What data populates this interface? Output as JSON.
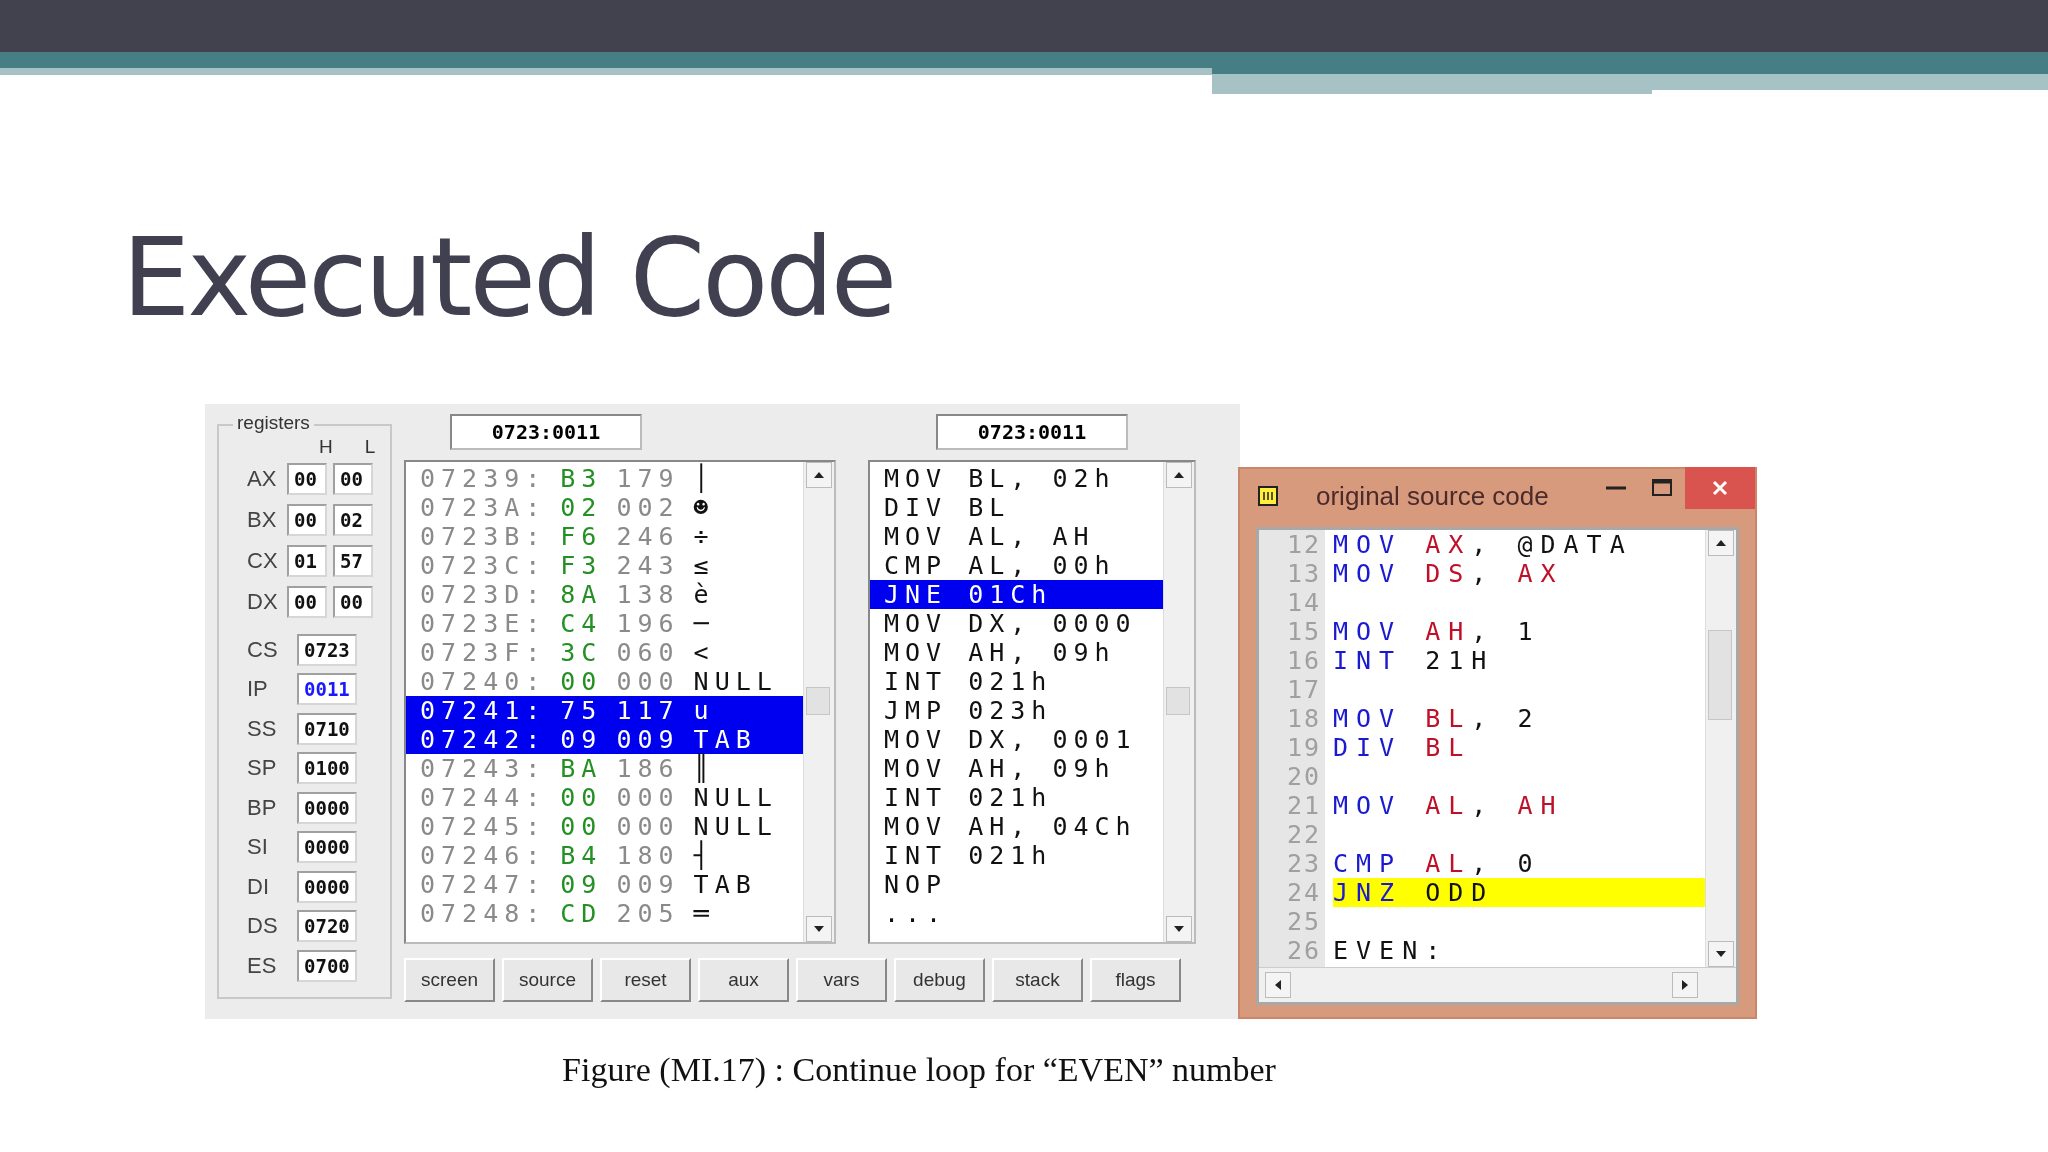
{
  "slide": {
    "title": "Executed Code",
    "caption": "Figure (MI.17) : Continue  loop for “EVEN” number"
  },
  "emulator": {
    "registers": {
      "label": "registers",
      "columns": [
        "H",
        "L"
      ],
      "pairs": [
        {
          "name": "AX",
          "high": "00",
          "low": "00"
        },
        {
          "name": "BX",
          "high": "00",
          "low": "02"
        },
        {
          "name": "CX",
          "high": "01",
          "low": "57"
        },
        {
          "name": "DX",
          "high": "00",
          "low": "00"
        }
      ],
      "segments": [
        {
          "name": "CS",
          "value": "0723",
          "changed": false
        },
        {
          "name": "IP",
          "value": "0011",
          "changed": true
        },
        {
          "name": "SS",
          "value": "0710",
          "changed": false
        },
        {
          "name": "SP",
          "value": "0100",
          "changed": false
        },
        {
          "name": "BP",
          "value": "0000",
          "changed": false
        },
        {
          "name": "SI",
          "value": "0000",
          "changed": false
        },
        {
          "name": "DI",
          "value": "0000",
          "changed": false
        },
        {
          "name": "DS",
          "value": "0720",
          "changed": false
        },
        {
          "name": "ES",
          "value": "0700",
          "changed": false
        }
      ]
    },
    "memory": {
      "address": "0723:0011",
      "rows": [
        {
          "address": "07239:",
          "hex": "B3",
          "decimal": "179",
          "char": "│",
          "selected": false
        },
        {
          "address": "0723A:",
          "hex": "02",
          "decimal": "002",
          "char": "☻",
          "selected": false
        },
        {
          "address": "0723B:",
          "hex": "F6",
          "decimal": "246",
          "char": "÷",
          "selected": false
        },
        {
          "address": "0723C:",
          "hex": "F3",
          "decimal": "243",
          "char": "≤",
          "selected": false
        },
        {
          "address": "0723D:",
          "hex": "8A",
          "decimal": "138",
          "char": "è",
          "selected": false
        },
        {
          "address": "0723E:",
          "hex": "C4",
          "decimal": "196",
          "char": "─",
          "selected": false
        },
        {
          "address": "0723F:",
          "hex": "3C",
          "decimal": "060",
          "char": "<",
          "selected": false
        },
        {
          "address": "07240:",
          "hex": "00",
          "decimal": "000",
          "char": "NULL",
          "selected": false
        },
        {
          "address": "07241:",
          "hex": "75",
          "decimal": "117",
          "char": "u",
          "selected": true
        },
        {
          "address": "07242:",
          "hex": "09",
          "decimal": "009",
          "char": "TAB",
          "selected": true
        },
        {
          "address": "07243:",
          "hex": "BA",
          "decimal": "186",
          "char": "║",
          "selected": false
        },
        {
          "address": "07244:",
          "hex": "00",
          "decimal": "000",
          "char": "NULL",
          "selected": false
        },
        {
          "address": "07245:",
          "hex": "00",
          "decimal": "000",
          "char": "NULL",
          "selected": false
        },
        {
          "address": "07246:",
          "hex": "B4",
          "decimal": "180",
          "char": "┤",
          "selected": false
        },
        {
          "address": "07247:",
          "hex": "09",
          "decimal": "009",
          "char": "TAB",
          "selected": false
        },
        {
          "address": "07248:",
          "hex": "CD",
          "decimal": "205",
          "char": "═",
          "selected": false
        }
      ]
    },
    "disassembly": {
      "address": "0723:0011",
      "lines": [
        {
          "text": "MOV BL, 02h",
          "selected": false
        },
        {
          "text": "DIV BL",
          "selected": false
        },
        {
          "text": "MOV AL, AH",
          "selected": false
        },
        {
          "text": "CMP AL, 00h",
          "selected": false
        },
        {
          "text": "JNE 01Ch",
          "selected": true
        },
        {
          "text": "MOV DX, 0000",
          "selected": false
        },
        {
          "text": "MOV AH, 09h",
          "selected": false
        },
        {
          "text": "INT 021h",
          "selected": false
        },
        {
          "text": "JMP 023h",
          "selected": false
        },
        {
          "text": "MOV DX, 0001",
          "selected": false
        },
        {
          "text": "MOV AH, 09h",
          "selected": false
        },
        {
          "text": "INT 021h",
          "selected": false
        },
        {
          "text": "MOV AH, 04Ch",
          "selected": false
        },
        {
          "text": "INT 021h",
          "selected": false
        },
        {
          "text": "NOP",
          "selected": false
        },
        {
          "text": "...",
          "selected": false
        }
      ]
    },
    "buttons": [
      "screen",
      "source",
      "reset",
      "aux",
      "vars",
      "debug",
      "stack",
      "flags"
    ]
  },
  "source_window": {
    "title": "original source code",
    "lines": [
      {
        "number": "12",
        "selected": false,
        "tokens": [
          {
            "text": "MOV",
            "kind": "keyword"
          },
          {
            "text": "AX",
            "kind": "register"
          },
          {
            "text": ",",
            "kind": "punct"
          },
          {
            "text": "@DATA",
            "kind": "literal"
          }
        ]
      },
      {
        "number": "13",
        "selected": false,
        "tokens": [
          {
            "text": "MOV",
            "kind": "keyword"
          },
          {
            "text": "DS",
            "kind": "register"
          },
          {
            "text": ",",
            "kind": "punct"
          },
          {
            "text": "AX",
            "kind": "register"
          }
        ]
      },
      {
        "number": "14",
        "selected": false
      },
      {
        "number": "15",
        "selected": false,
        "tokens": [
          {
            "text": "MOV",
            "kind": "keyword"
          },
          {
            "text": "AH",
            "kind": "register"
          },
          {
            "text": ",",
            "kind": "punct"
          },
          {
            "text": "1",
            "kind": "literal"
          }
        ]
      },
      {
        "number": "16",
        "selected": false,
        "tokens": [
          {
            "text": "INT",
            "kind": "keyword"
          },
          {
            "text": "21H",
            "kind": "literal"
          }
        ]
      },
      {
        "number": "17",
        "selected": false
      },
      {
        "number": "18",
        "selected": false,
        "tokens": [
          {
            "text": "MOV",
            "kind": "keyword"
          },
          {
            "text": "BL",
            "kind": "register"
          },
          {
            "text": ",",
            "kind": "punct"
          },
          {
            "text": "2",
            "kind": "literal"
          }
        ]
      },
      {
        "number": "19",
        "selected": false,
        "tokens": [
          {
            "text": "DIV",
            "kind": "keyword"
          },
          {
            "text": "BL",
            "kind": "register"
          }
        ]
      },
      {
        "number": "20",
        "selected": false
      },
      {
        "number": "21",
        "selected": false,
        "tokens": [
          {
            "text": "MOV",
            "kind": "keyword"
          },
          {
            "text": "AL",
            "kind": "register"
          },
          {
            "text": ",",
            "kind": "punct"
          },
          {
            "text": "AH",
            "kind": "register"
          }
        ]
      },
      {
        "number": "22",
        "selected": false
      },
      {
        "number": "23",
        "selected": false,
        "tokens": [
          {
            "text": "CMP",
            "kind": "keyword"
          },
          {
            "text": "AL",
            "kind": "register"
          },
          {
            "text": ",",
            "kind": "punct"
          },
          {
            "text": "0",
            "kind": "literal"
          }
        ]
      },
      {
        "number": "24",
        "selected": true,
        "tokens": [
          {
            "text": "JNZ",
            "kind": "keyword"
          },
          {
            "text": "ODD",
            "kind": "literal"
          }
        ]
      },
      {
        "number": "25",
        "selected": false
      },
      {
        "number": "26",
        "selected": false,
        "tokens": [
          {
            "text": "EVEN:",
            "kind": "literal"
          }
        ]
      }
    ]
  }
}
